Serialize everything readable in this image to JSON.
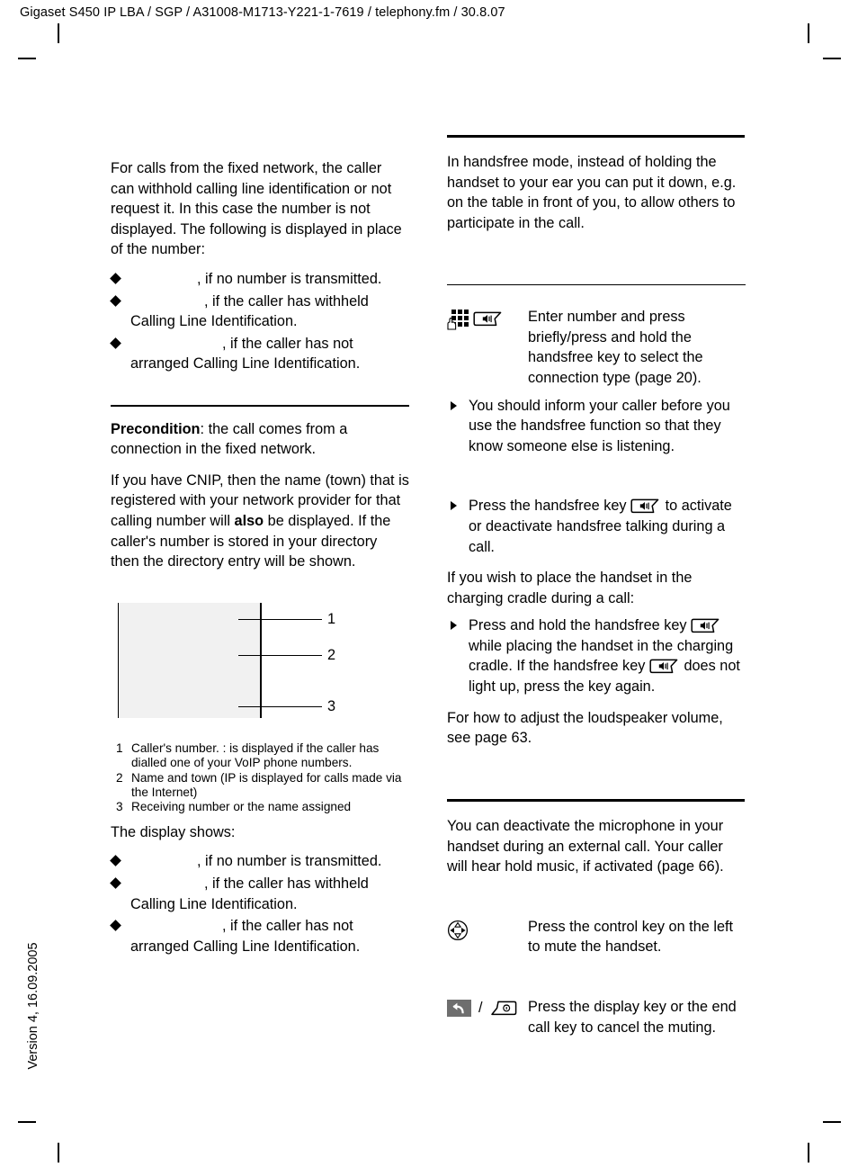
{
  "header": {
    "running_head": "Gigaset S450 IP LBA / SGP / A31008-M1713-Y221-1-7619 / telephony.fm / 30.8.07"
  },
  "footer": {
    "version": "Version 4, 16.09.2005"
  },
  "left_column": {
    "intro": "For calls from the fixed network, the caller can withhold calling line identification or not request it. In this case the number is not displayed. The following is displayed in place of the number:",
    "bullets_1": [
      {
        "value": "",
        "text": ", if no number is transmitted."
      },
      {
        "value": "",
        "text": ", if the caller has withheld Calling Line Identification."
      },
      {
        "value": "",
        "text": ", if the caller has not arranged Calling Line Identification."
      }
    ],
    "precondition_label": "Precondition",
    "precondition_text": ": the call comes from a connection in the fixed network.",
    "cnip_para_1": "If you have CNIP, then the name (town) that is registered with your network provider for that calling number will ",
    "cnip_bold": "also",
    "cnip_para_2": " be displayed. If the caller's number is stored in your directory then the directory entry will be shown.",
    "figure": {
      "callouts": [
        "1",
        "2",
        "3"
      ]
    },
    "figure_caption": [
      {
        "n": "1",
        "text": "Caller's number.    : is displayed if the caller has dialled one of your VoIP phone numbers."
      },
      {
        "n": "2",
        "text": "Name and town (IP is displayed for calls made via the Internet)"
      },
      {
        "n": "3",
        "text": "Receiving number or the name assigned"
      }
    ],
    "display_shows": "The display shows:",
    "bullets_2": [
      {
        "value": "",
        "text": ", if no number is transmitted."
      },
      {
        "value": "",
        "text": ", if the caller has withheld Calling Line Identification."
      },
      {
        "value": "",
        "text": ", if the caller has not arranged Calling Line Identification."
      }
    ]
  },
  "right_column": {
    "handsfree_intro": "In handsfree mode, instead of holding the handset to your ear you can put it down, e.g. on the table in front of you, to allow others to participate in the call.",
    "key_row_1": {
      "icons": [
        "keypad-icon",
        "handsfree-key-icon"
      ],
      "text": "Enter number and press briefly/press and hold the handsfree key to select the connection type (page 20)."
    },
    "tip_1": "You should inform your caller before you use the handsfree function so that they know someone else is listening.",
    "bullet_press_a": "Press the handsfree key ",
    "bullet_press_b": " to activate or deactivate handsfree talking during a call.",
    "cradle_para": "If you wish to place the handset in the charging cradle during a call:",
    "bullet_hold_a": "Press and hold the handsfree key ",
    "bullet_hold_b": " while placing the handset in the charging cradle. If the handsfree key ",
    "bullet_hold_c": " does not light up, press the key again.",
    "volume_para": "For how to adjust the loudspeaker volume, see page 63.",
    "mute_intro": "You can deactivate the microphone in your handset during an external call. Your caller will hear hold music, if activated (page 66).",
    "key_row_2": {
      "icons": [
        "control-key-icon"
      ],
      "text": "Press the control key on the left to mute the handset."
    },
    "key_row_3": {
      "icons": [
        "display-key-icon",
        "end-call-key-icon"
      ],
      "separator": "/",
      "text": "Press the display key or the end call key to cancel the muting."
    }
  },
  "colors": {
    "text": "#000000",
    "screen_fill": "#f1f1f1",
    "display_key_fill": "#6e6e6e",
    "page_background": "#ffffff"
  }
}
